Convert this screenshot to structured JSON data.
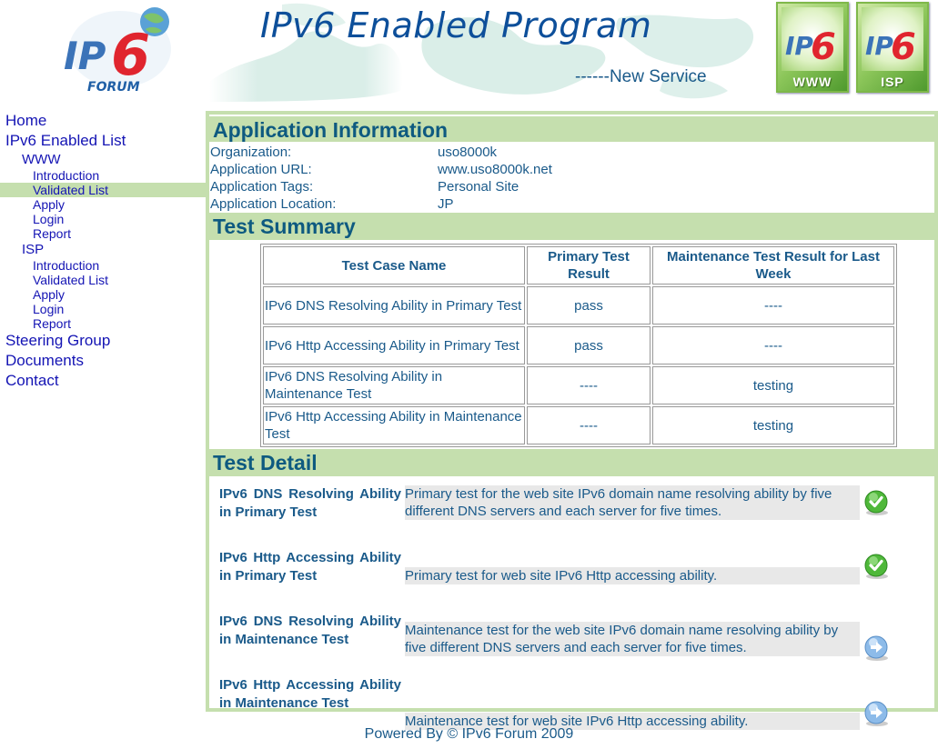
{
  "header": {
    "title": "IPv6 Enabled Program",
    "subtitle": "------New Service",
    "logo_text_main": "IPv6",
    "logo_text_sub": "FORUM",
    "badge_www": "WWW",
    "badge_isp": "ISP",
    "badge_mark": "v6"
  },
  "sidebar": {
    "home": "Home",
    "enabled_list": "IPv6 Enabled List",
    "www": {
      "label": "WWW",
      "items": [
        "Introduction",
        "Validated List",
        "Apply",
        "Login",
        "Report"
      ]
    },
    "isp": {
      "label": "ISP",
      "items": [
        "Introduction",
        "Validated List",
        "Apply",
        "Login",
        "Report"
      ]
    },
    "steering": "Steering Group",
    "documents": "Documents",
    "contact": "Contact",
    "active_item": "www.Validated List"
  },
  "app_info": {
    "heading": "Application Information",
    "rows": [
      {
        "label": "Organization:",
        "value": "uso8000k"
      },
      {
        "label": "Application URL:",
        "value": "www.uso8000k.net"
      },
      {
        "label": "Application Tags:",
        "value": "Personal Site"
      },
      {
        "label": "Application Location:",
        "value": "JP"
      }
    ]
  },
  "summary": {
    "heading": "Test Summary",
    "columns": [
      "Test Case Name",
      "Primary Test Result",
      "Maintenance Test Result for Last Week"
    ],
    "rows": [
      {
        "name": "IPv6 DNS Resolving Ability in Primary Test",
        "primary": "pass",
        "maintenance": "----"
      },
      {
        "name": "IPv6 Http Accessing Ability in Primary Test",
        "primary": "pass",
        "maintenance": "----"
      },
      {
        "name": "IPv6 DNS Resolving Ability in Maintenance Test",
        "primary": "----",
        "maintenance": "testing"
      },
      {
        "name": "IPv6 Http Accessing Ability in Maintenance Test",
        "primary": "----",
        "maintenance": "testing"
      }
    ]
  },
  "detail": {
    "heading": "Test Detail",
    "rows": [
      {
        "name": "IPv6 DNS Resolving Ability in Primary Test",
        "desc": "Primary test for the web site IPv6 domain name resolving ability by five different DNS servers and each server for five times.",
        "icon": "check-icon"
      },
      {
        "name": "IPv6 Http Accessing Ability in Primary Test",
        "desc": "Primary test for web site IPv6 Http accessing ability.",
        "icon": "check-icon"
      },
      {
        "name": "IPv6 DNS Resolving Ability in Maintenance Test",
        "desc": "Maintenance test for the web site IPv6 domain name resolving ability by five different DNS servers and each server for five times.",
        "icon": "arrow-right-icon"
      },
      {
        "name": "IPv6 Http Accessing Ability in Maintenance Test",
        "desc": "Maintenance test for web site IPv6 Http accessing ability.",
        "icon": "arrow-right-icon"
      }
    ]
  },
  "footer": {
    "text": "Powered By © IPv6 Forum 2009"
  },
  "colors": {
    "accent_green": "#c5dfae",
    "link_blue": "#1414b4",
    "text_teal": "#1a5a8a",
    "title_blue": "#0d4f9a"
  }
}
